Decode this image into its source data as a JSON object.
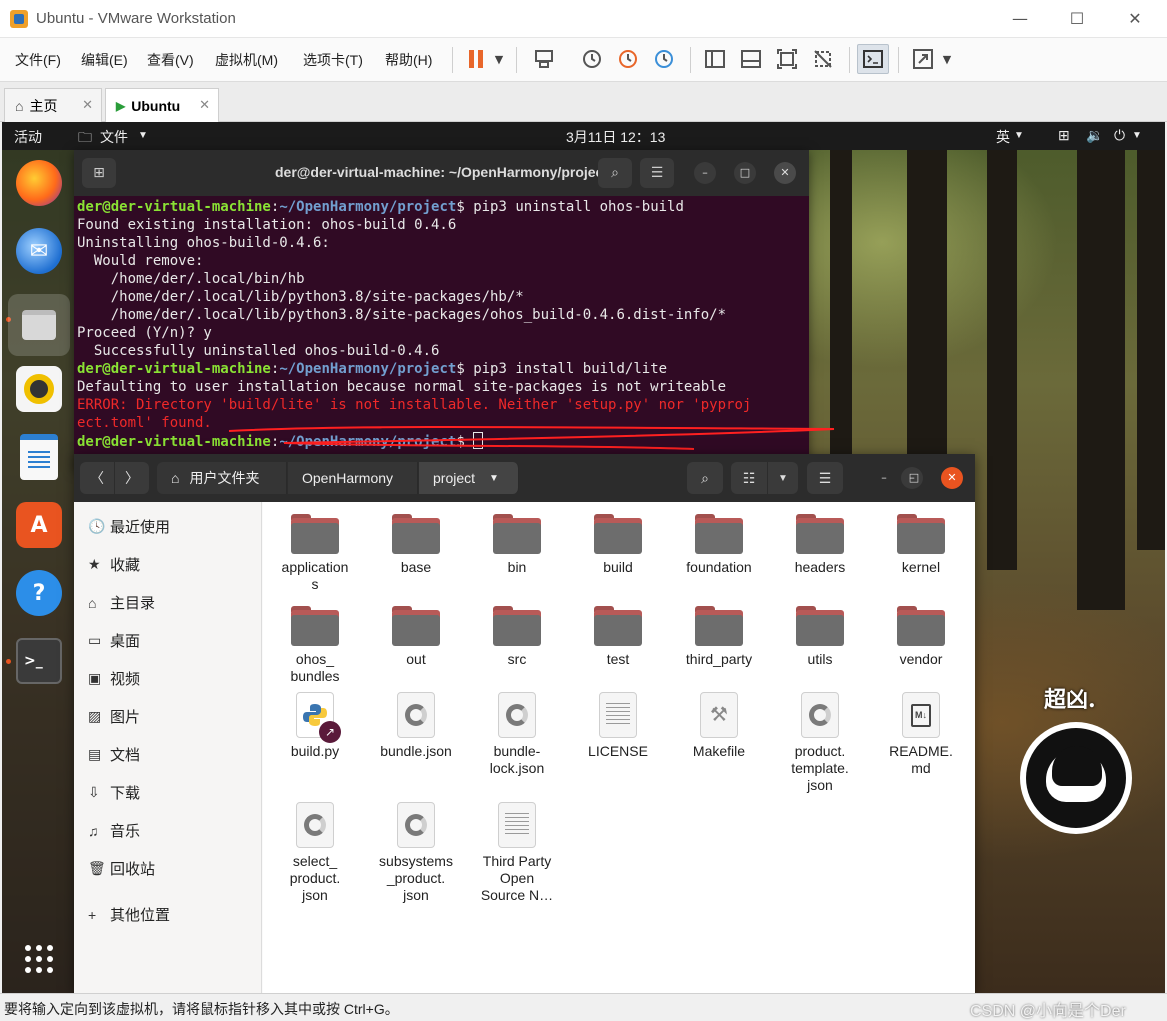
{
  "vmware": {
    "window_title": "Ubuntu - VMware Workstation",
    "menu": [
      "文件(F)",
      "编辑(E)",
      "查看(V)",
      "虚拟机(M)",
      "选项卡(T)",
      "帮助(H)"
    ],
    "tabs": [
      {
        "label": "主页"
      },
      {
        "label": "Ubuntu"
      }
    ],
    "status_message": "要将输入定向到该虚拟机，请将鼠标指针移入其中或按 Ctrl+G。",
    "watermark": "CSDN @小向是个Der",
    "accent_color": "#f0a02a",
    "pause_color": "#e8662a"
  },
  "ubuntu": {
    "activities": "活动",
    "app_menu": "文件",
    "clock": "3月11日  12：13",
    "input_method": "英",
    "accent_color": "#e95420"
  },
  "terminal": {
    "title": "der@der-virtual-machine: ~/OpenHarmony/project",
    "prompt_user": "der@der-virtual-machine",
    "prompt_path": "~/OpenHarmony/project",
    "lines": [
      {
        "type": "cmd",
        "text": " pip3 uninstall ohos-build"
      },
      {
        "type": "out",
        "text": "Found existing installation: ohos-build 0.4.6"
      },
      {
        "type": "out",
        "text": "Uninstalling ohos-build-0.4.6:"
      },
      {
        "type": "out",
        "text": "  Would remove:"
      },
      {
        "type": "out",
        "text": "    /home/der/.local/bin/hb"
      },
      {
        "type": "out",
        "text": "    /home/der/.local/lib/python3.8/site-packages/hb/*"
      },
      {
        "type": "out",
        "text": "    /home/der/.local/lib/python3.8/site-packages/ohos_build-0.4.6.dist-info/*"
      },
      {
        "type": "out",
        "text": "Proceed (Y/n)? y"
      },
      {
        "type": "out",
        "text": "  Successfully uninstalled ohos-build-0.4.6"
      },
      {
        "type": "cmd",
        "text": " pip3 install build/lite"
      },
      {
        "type": "out",
        "text": "Defaulting to user installation because normal site-packages is not writeable"
      },
      {
        "type": "err",
        "text": "ERROR: Directory 'build/lite' is not installable. Neither 'setup.py' nor 'pyproj"
      },
      {
        "type": "err",
        "text": "ect.toml' found."
      },
      {
        "type": "cmd",
        "text": " "
      }
    ]
  },
  "files": {
    "breadcrumb": [
      "用户文件夹",
      "OpenHarmony",
      "project"
    ],
    "sidebar": [
      {
        "label": "最近使用",
        "icon": "clock-icon"
      },
      {
        "label": "收藏",
        "icon": "star-icon"
      },
      {
        "label": "主目录",
        "icon": "home-icon"
      },
      {
        "label": "桌面",
        "icon": "desktop-icon"
      },
      {
        "label": "视频",
        "icon": "video-icon"
      },
      {
        "label": "图片",
        "icon": "image-icon"
      },
      {
        "label": "文档",
        "icon": "document-icon"
      },
      {
        "label": "下载",
        "icon": "download-icon"
      },
      {
        "label": "音乐",
        "icon": "music-icon"
      },
      {
        "label": "回收站",
        "icon": "trash-icon"
      },
      {
        "label": "其他位置",
        "icon": "plus-icon"
      }
    ],
    "items": [
      {
        "name": "application\ns",
        "kind": "folder"
      },
      {
        "name": "base",
        "kind": "folder"
      },
      {
        "name": "bin",
        "kind": "folder"
      },
      {
        "name": "build",
        "kind": "folder"
      },
      {
        "name": "foundation",
        "kind": "folder"
      },
      {
        "name": "headers",
        "kind": "folder"
      },
      {
        "name": "kernel",
        "kind": "folder"
      },
      {
        "name": "ohos_\nbundles",
        "kind": "folder"
      },
      {
        "name": "out",
        "kind": "folder"
      },
      {
        "name": "src",
        "kind": "folder"
      },
      {
        "name": "test",
        "kind": "folder"
      },
      {
        "name": "third_party",
        "kind": "folder"
      },
      {
        "name": "utils",
        "kind": "folder"
      },
      {
        "name": "vendor",
        "kind": "folder"
      },
      {
        "name": "build.py",
        "kind": "python"
      },
      {
        "name": "bundle.json",
        "kind": "json"
      },
      {
        "name": "bundle-\nlock.json",
        "kind": "json"
      },
      {
        "name": "LICENSE",
        "kind": "text"
      },
      {
        "name": "Makefile",
        "kind": "makefile"
      },
      {
        "name": "product.\ntemplate.\njson",
        "kind": "json"
      },
      {
        "name": "README.\nmd",
        "kind": "markdown"
      },
      {
        "name": "select_\nproduct.\njson",
        "kind": "json"
      },
      {
        "name": "subsystems\n_product.\njson",
        "kind": "json"
      },
      {
        "name": "Third Party\nOpen\nSource N…",
        "kind": "text"
      }
    ]
  },
  "sticker": {
    "text": "超凶."
  }
}
